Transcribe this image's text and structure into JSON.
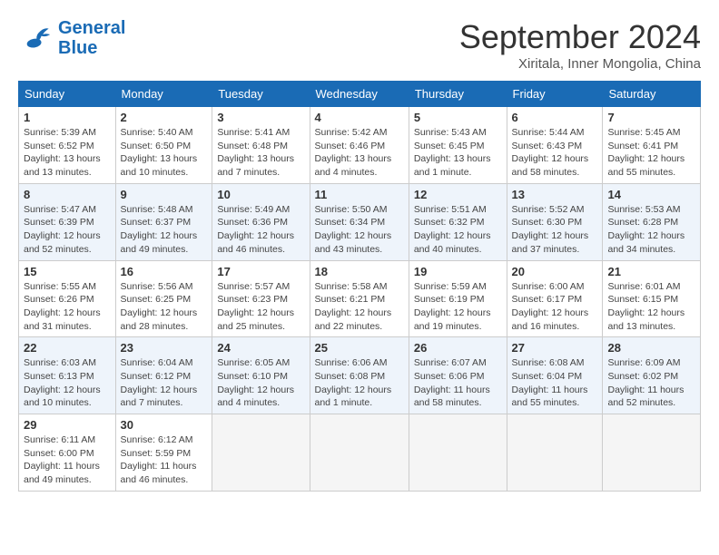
{
  "header": {
    "logo_line1": "General",
    "logo_line2": "Blue",
    "month": "September 2024",
    "location": "Xiritala, Inner Mongolia, China"
  },
  "weekdays": [
    "Sunday",
    "Monday",
    "Tuesday",
    "Wednesday",
    "Thursday",
    "Friday",
    "Saturday"
  ],
  "weeks": [
    [
      {
        "day": "1",
        "info": "Sunrise: 5:39 AM\nSunset: 6:52 PM\nDaylight: 13 hours\nand 13 minutes."
      },
      {
        "day": "2",
        "info": "Sunrise: 5:40 AM\nSunset: 6:50 PM\nDaylight: 13 hours\nand 10 minutes."
      },
      {
        "day": "3",
        "info": "Sunrise: 5:41 AM\nSunset: 6:48 PM\nDaylight: 13 hours\nand 7 minutes."
      },
      {
        "day": "4",
        "info": "Sunrise: 5:42 AM\nSunset: 6:46 PM\nDaylight: 13 hours\nand 4 minutes."
      },
      {
        "day": "5",
        "info": "Sunrise: 5:43 AM\nSunset: 6:45 PM\nDaylight: 13 hours\nand 1 minute."
      },
      {
        "day": "6",
        "info": "Sunrise: 5:44 AM\nSunset: 6:43 PM\nDaylight: 12 hours\nand 58 minutes."
      },
      {
        "day": "7",
        "info": "Sunrise: 5:45 AM\nSunset: 6:41 PM\nDaylight: 12 hours\nand 55 minutes."
      }
    ],
    [
      {
        "day": "8",
        "info": "Sunrise: 5:47 AM\nSunset: 6:39 PM\nDaylight: 12 hours\nand 52 minutes."
      },
      {
        "day": "9",
        "info": "Sunrise: 5:48 AM\nSunset: 6:37 PM\nDaylight: 12 hours\nand 49 minutes."
      },
      {
        "day": "10",
        "info": "Sunrise: 5:49 AM\nSunset: 6:36 PM\nDaylight: 12 hours\nand 46 minutes."
      },
      {
        "day": "11",
        "info": "Sunrise: 5:50 AM\nSunset: 6:34 PM\nDaylight: 12 hours\nand 43 minutes."
      },
      {
        "day": "12",
        "info": "Sunrise: 5:51 AM\nSunset: 6:32 PM\nDaylight: 12 hours\nand 40 minutes."
      },
      {
        "day": "13",
        "info": "Sunrise: 5:52 AM\nSunset: 6:30 PM\nDaylight: 12 hours\nand 37 minutes."
      },
      {
        "day": "14",
        "info": "Sunrise: 5:53 AM\nSunset: 6:28 PM\nDaylight: 12 hours\nand 34 minutes."
      }
    ],
    [
      {
        "day": "15",
        "info": "Sunrise: 5:55 AM\nSunset: 6:26 PM\nDaylight: 12 hours\nand 31 minutes."
      },
      {
        "day": "16",
        "info": "Sunrise: 5:56 AM\nSunset: 6:25 PM\nDaylight: 12 hours\nand 28 minutes."
      },
      {
        "day": "17",
        "info": "Sunrise: 5:57 AM\nSunset: 6:23 PM\nDaylight: 12 hours\nand 25 minutes."
      },
      {
        "day": "18",
        "info": "Sunrise: 5:58 AM\nSunset: 6:21 PM\nDaylight: 12 hours\nand 22 minutes."
      },
      {
        "day": "19",
        "info": "Sunrise: 5:59 AM\nSunset: 6:19 PM\nDaylight: 12 hours\nand 19 minutes."
      },
      {
        "day": "20",
        "info": "Sunrise: 6:00 AM\nSunset: 6:17 PM\nDaylight: 12 hours\nand 16 minutes."
      },
      {
        "day": "21",
        "info": "Sunrise: 6:01 AM\nSunset: 6:15 PM\nDaylight: 12 hours\nand 13 minutes."
      }
    ],
    [
      {
        "day": "22",
        "info": "Sunrise: 6:03 AM\nSunset: 6:13 PM\nDaylight: 12 hours\nand 10 minutes."
      },
      {
        "day": "23",
        "info": "Sunrise: 6:04 AM\nSunset: 6:12 PM\nDaylight: 12 hours\nand 7 minutes."
      },
      {
        "day": "24",
        "info": "Sunrise: 6:05 AM\nSunset: 6:10 PM\nDaylight: 12 hours\nand 4 minutes."
      },
      {
        "day": "25",
        "info": "Sunrise: 6:06 AM\nSunset: 6:08 PM\nDaylight: 12 hours\nand 1 minute."
      },
      {
        "day": "26",
        "info": "Sunrise: 6:07 AM\nSunset: 6:06 PM\nDaylight: 11 hours\nand 58 minutes."
      },
      {
        "day": "27",
        "info": "Sunrise: 6:08 AM\nSunset: 6:04 PM\nDaylight: 11 hours\nand 55 minutes."
      },
      {
        "day": "28",
        "info": "Sunrise: 6:09 AM\nSunset: 6:02 PM\nDaylight: 11 hours\nand 52 minutes."
      }
    ],
    [
      {
        "day": "29",
        "info": "Sunrise: 6:11 AM\nSunset: 6:00 PM\nDaylight: 11 hours\nand 49 minutes."
      },
      {
        "day": "30",
        "info": "Sunrise: 6:12 AM\nSunset: 5:59 PM\nDaylight: 11 hours\nand 46 minutes."
      },
      {
        "day": "",
        "info": ""
      },
      {
        "day": "",
        "info": ""
      },
      {
        "day": "",
        "info": ""
      },
      {
        "day": "",
        "info": ""
      },
      {
        "day": "",
        "info": ""
      }
    ]
  ]
}
